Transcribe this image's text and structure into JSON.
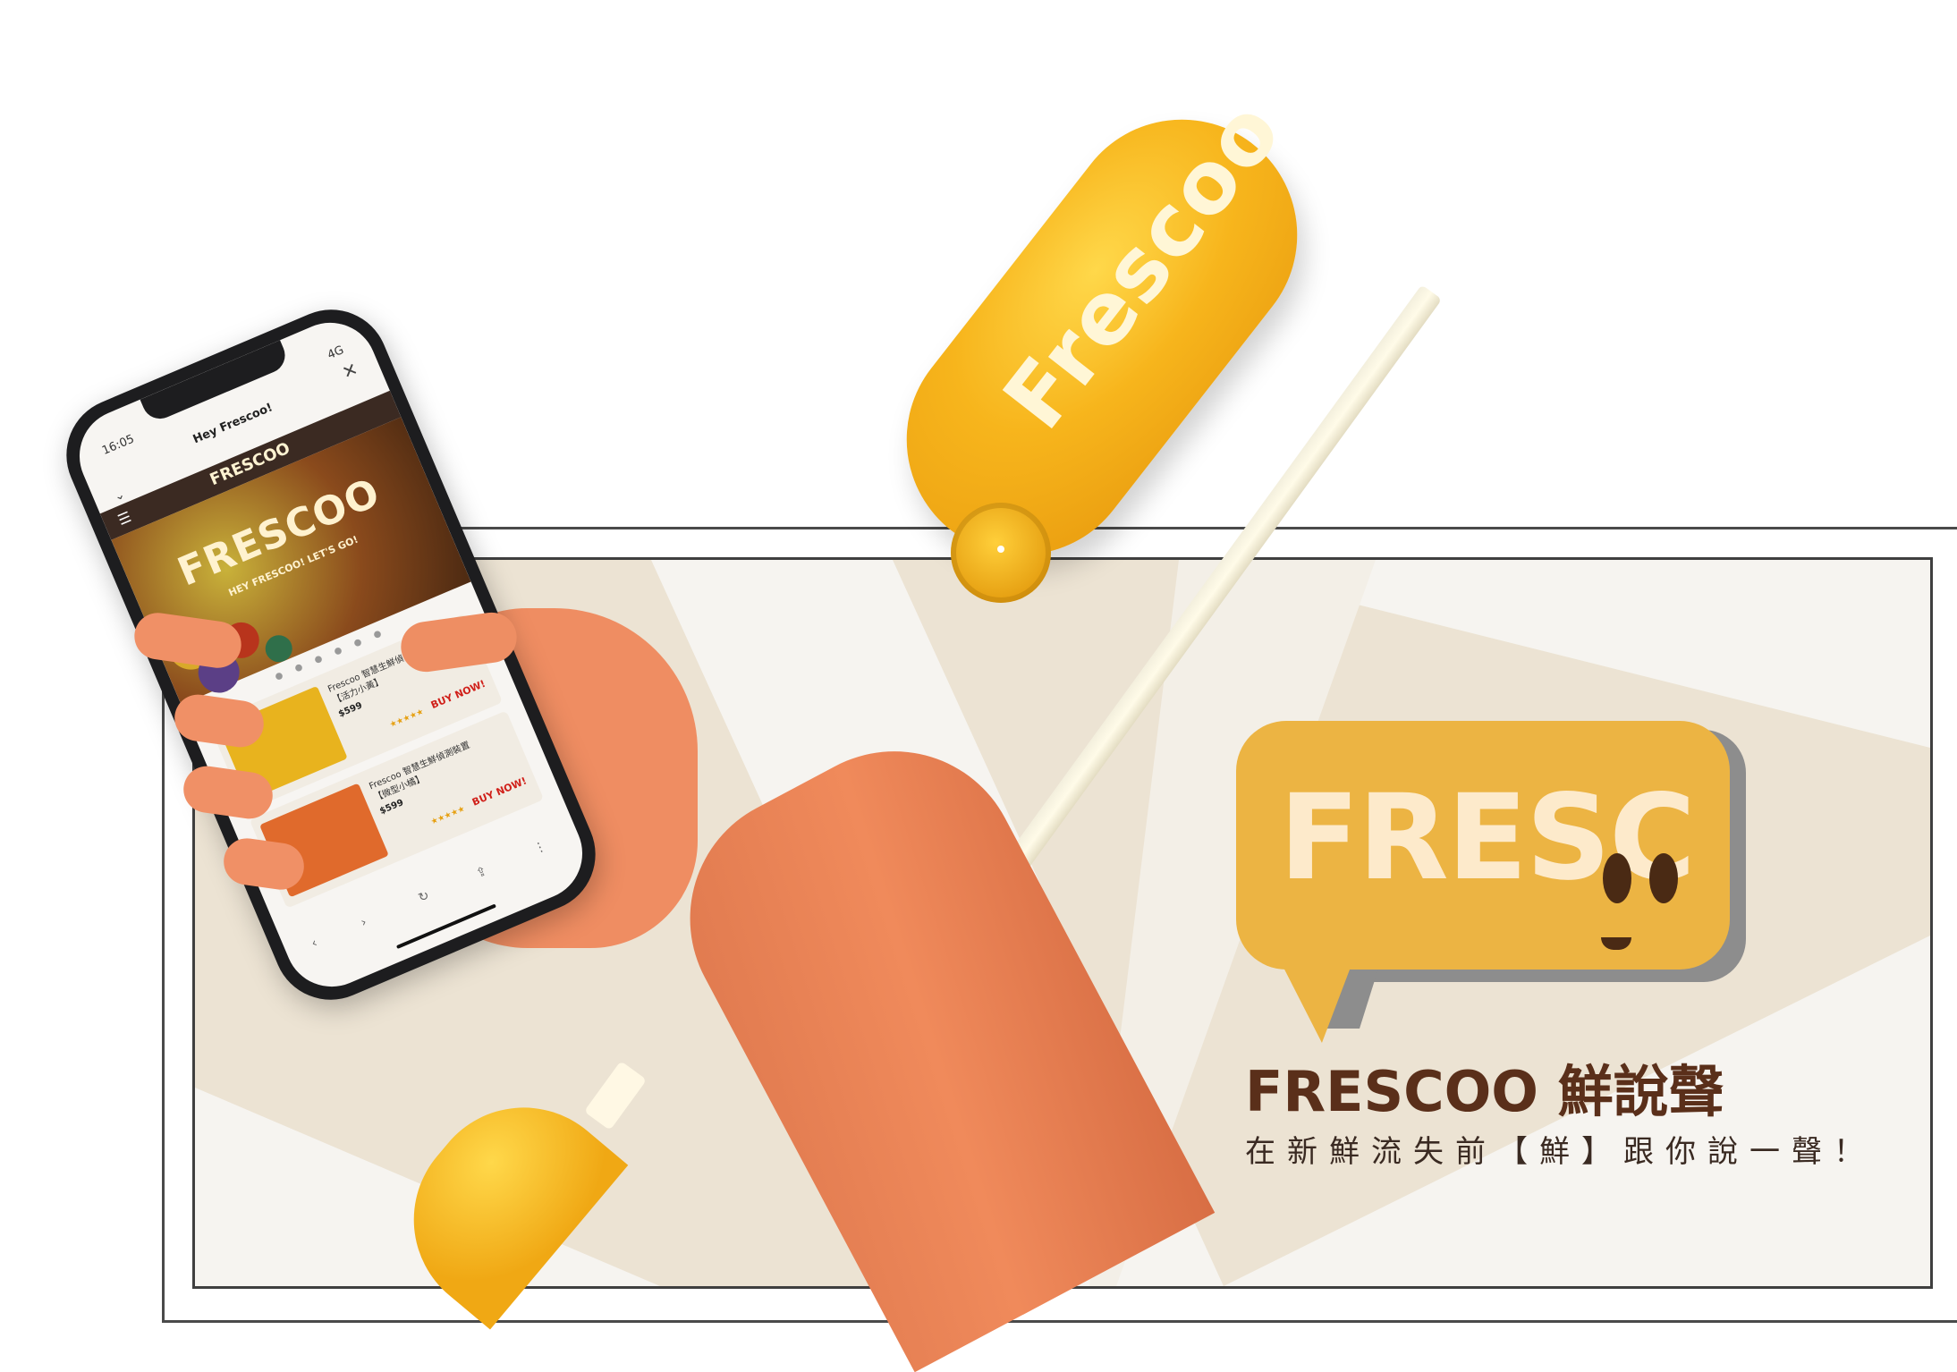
{
  "phone": {
    "status_time": "16:05",
    "status_network": "4G",
    "browser_title": "Hey Frescoo!",
    "site_logo": "FRESCOO",
    "hero_logo": "FRESCOO",
    "hero_tagline": "HEY FRESCOO! LET'S GO!",
    "carousel_dots": "● ● ● ● ● ●",
    "products": [
      {
        "name": "Frescoo 智慧生鮮偵",
        "variant": "【活力小黃】",
        "price": "$599",
        "stars": "★★★★★",
        "buy": "BUY NOW!",
        "color": "#e8b31e"
      },
      {
        "name": "Frescoo 智慧生鮮偵測裝置",
        "variant": "【微型小橘】",
        "price": "$599",
        "stars": "★★★★★",
        "buy": "BUY NOW!",
        "color": "#e06a2c"
      }
    ]
  },
  "device": {
    "logo_text": "Frescoo"
  },
  "bubble": {
    "logo_text": "FRESC"
  },
  "brand": {
    "name": "FRESCOO",
    "chinese_name": "鮮說聲",
    "slogan": "在新鮮流失前【鮮】跟你說一聲！"
  },
  "colors": {
    "brand_yellow": "#ecb443",
    "brand_brown": "#5a2f1a",
    "device_orange": "#f7b51c",
    "background_beige": "#ece3d3"
  }
}
